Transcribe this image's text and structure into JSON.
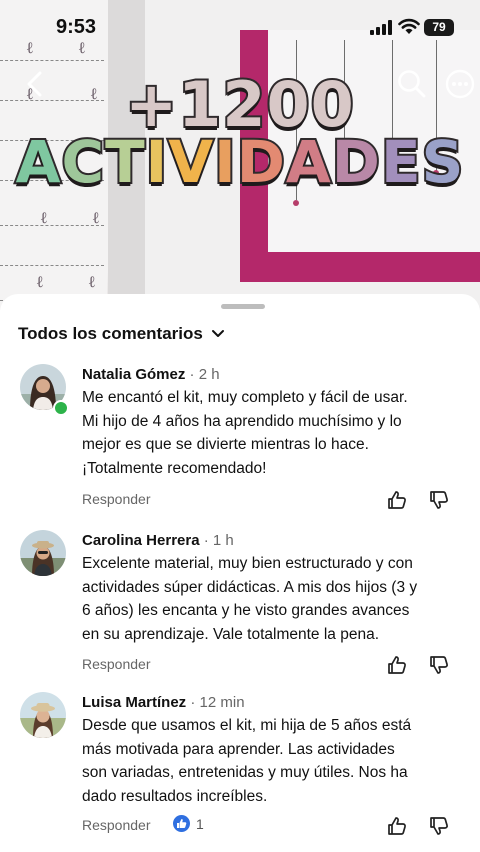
{
  "status_bar": {
    "time": "9:53",
    "battery": "79"
  },
  "video_overlay": {
    "title_line1": "+1200",
    "title_line2_letters": [
      "A",
      "C",
      "T",
      "I",
      "V",
      "I",
      "D",
      "A",
      "D",
      "E",
      "S"
    ]
  },
  "comments_panel": {
    "title": "Todos los comentarios",
    "sort_icon": "chevron-down-icon",
    "reply_label": "Responder",
    "comments": [
      {
        "author": "Natalia Gómez",
        "time": "· 2 h",
        "text": "Me encantó el kit, muy completo y fácil de usar. Mi hijo de 4 años ha aprendido muchísimo y lo mejor es que se divierte mientras lo hace. ¡Totalmente recomendado!",
        "online": true
      },
      {
        "author": "Carolina Herrera",
        "time": "· 1 h",
        "text": "Excelente material, muy bien estructurado y con actividades súper didácticas. A mis dos hijos (3 y 6 años) les encanta y he visto grandes avances en su aprendizaje. Vale totalmente la pena.",
        "online": false
      },
      {
        "author": "Luisa Martínez",
        "time": "· 12 min",
        "text": "Desde que usamos el kit, mi hija de 5 años está más motivada para aprender. Las actividades son variadas, entretenidas y muy útiles. Nos ha dado resultados increíbles.",
        "online": false,
        "reaction_count": "1"
      }
    ]
  },
  "colors": {
    "accent_blue": "#2f6fe0",
    "online_green": "#2db34a",
    "frame_pink": "#b4286a"
  }
}
